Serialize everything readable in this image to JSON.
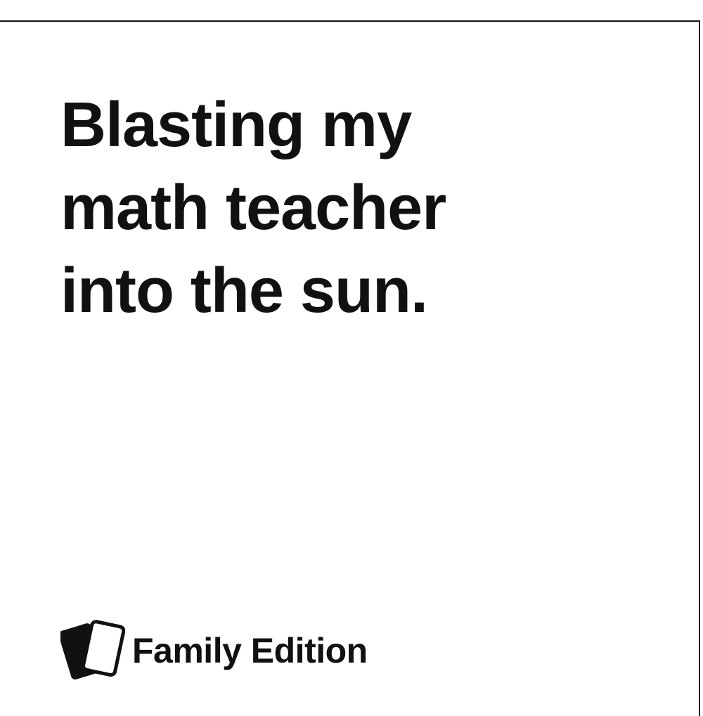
{
  "card": {
    "text": "Blasting my\nmath teacher\ninto the sun.",
    "brand_label": "Family Edition",
    "brand_icon": "cards-icon",
    "colors": {
      "text": "#111111",
      "background": "#ffffff",
      "border": "#111111"
    }
  }
}
